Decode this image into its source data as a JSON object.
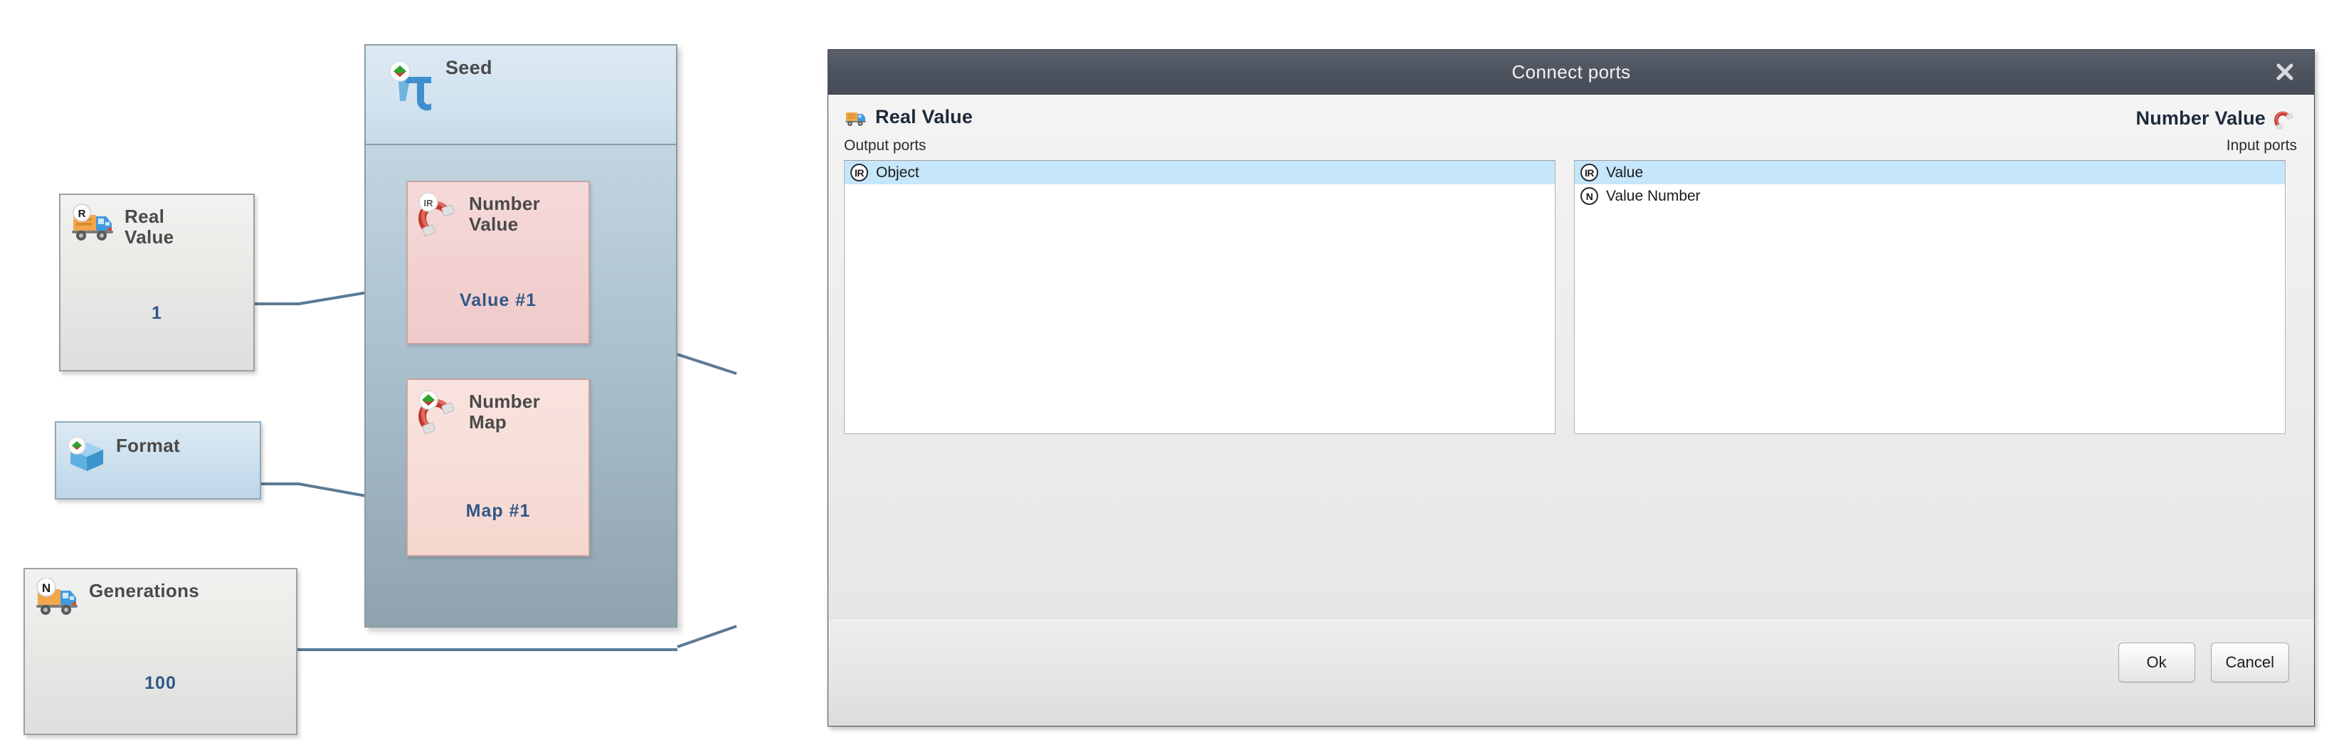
{
  "diagram": {
    "nodes": [
      {
        "id": "real-value",
        "title": "Real\nValue",
        "value": "1",
        "icon": "truck-r-icon"
      },
      {
        "id": "format",
        "title": "Format",
        "value": "",
        "icon": "blue-box-icon"
      },
      {
        "id": "generations",
        "title": "Generations",
        "value": "100",
        "icon": "truck-n-icon"
      }
    ],
    "container": {
      "title": "Seed",
      "icon": "pi-icon",
      "children": [
        {
          "id": "number-value",
          "title": "Number\nValue",
          "value": "Value #1",
          "icon": "magnet-ir-icon"
        },
        {
          "id": "number-map",
          "title": "Number\nMap",
          "value": "Map #1",
          "icon": "magnet-map-icon"
        }
      ]
    }
  },
  "dialog": {
    "title": "Connect ports",
    "close_icon": "close-icon",
    "left": {
      "title": "Real Value",
      "icon": "truck-icon",
      "subtitle": "Output ports",
      "items": [
        {
          "badge": "IR",
          "label": "Object",
          "selected": true
        }
      ]
    },
    "right": {
      "title": "Number Value",
      "icon": "magnet-icon",
      "subtitle": "Input ports",
      "items": [
        {
          "badge": "IR",
          "label": "Value",
          "selected": true
        },
        {
          "badge": "N",
          "label": "Value Number",
          "selected": false
        }
      ]
    },
    "buttons": {
      "ok": "Ok",
      "cancel": "Cancel"
    }
  },
  "colors": {
    "titlebar": "#4e545f",
    "selection": "#c5e6fb",
    "value_text": "#2f5787",
    "node_pink": "#f2cfcf",
    "node_blue": "#cde0ee",
    "wire": "#5c7a94"
  }
}
